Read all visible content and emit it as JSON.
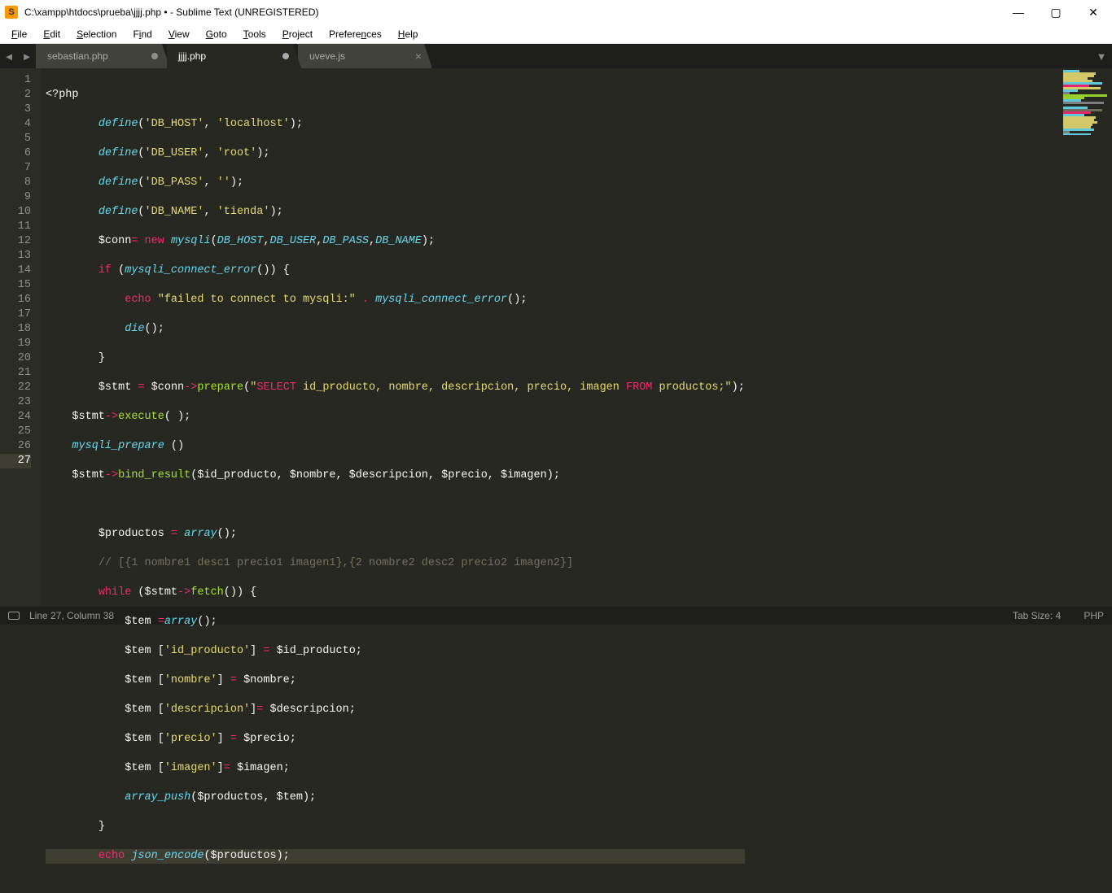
{
  "window": {
    "icon_letter": "S",
    "title": "C:\\xampp\\htdocs\\prueba\\jjjj.php • - Sublime Text (UNREGISTERED)"
  },
  "menu": {
    "file": "File",
    "edit": "Edit",
    "selection": "Selection",
    "find": "Find",
    "view": "View",
    "goto": "Goto",
    "tools": "Tools",
    "project": "Project",
    "preferences": "Preferences",
    "help": "Help"
  },
  "tabs": {
    "t1": "sebastian.php",
    "t2": "jjjj.php",
    "t3": "uveve.js"
  },
  "status": {
    "pos": "Line 27, Column 38",
    "tabsize": "Tab Size: 4",
    "lang": "PHP"
  },
  "gutter": [
    "1",
    "2",
    "3",
    "4",
    "5",
    "6",
    "7",
    "8",
    "9",
    "10",
    "11",
    "12",
    "13",
    "14",
    "15",
    "16",
    "17",
    "18",
    "19",
    "20",
    "21",
    "22",
    "23",
    "24",
    "25",
    "26",
    "27"
  ],
  "code": {
    "l1a": "<?php",
    "l2_def": "define",
    "l2_s1": "'DB_HOST'",
    "l2_s2": "'localhost'",
    "l3_s1": "'DB_USER'",
    "l3_s2": "'root'",
    "l4_s1": "'DB_PASS'",
    "l4_s2": "''",
    "l5_s1": "'DB_NAME'",
    "l5_s2": "'tienda'",
    "l6_conn": "$conn",
    "l6_new": "new",
    "l6_mysqli": "mysqli",
    "l6_c1": "DB_HOST",
    "l6_c2": "DB_USER",
    "l6_c3": "DB_PASS",
    "l6_c4": "DB_NAME",
    "l7_if": "if",
    "l7_fn": "mysqli_connect_error",
    "l8_echo": "echo",
    "l8_str": "\"failed to connect to mysqli:\"",
    "l8_fn": "mysqli_connect_error",
    "l9_die": "die",
    "l11_stmt": "$stmt",
    "l11_conn": "$conn",
    "l11_prep": "prepare",
    "l11_sql_sel": "SELECT",
    "l11_sql_mid": " id_producto, nombre, descripcion, precio, imagen ",
    "l11_sql_from": "FROM",
    "l11_sql_end": " productos;",
    "l12_stmt": "$stmt",
    "l12_exec": "execute",
    "l13_fn": "mysqli_prepare",
    "l14_stmt": "$stmt",
    "l14_bind": "bind_result",
    "l14_args": "($id_producto, $nombre, $descripcion, $precio, $imagen);",
    "l16_prod": "$productos",
    "l16_arr": "array",
    "l17_c": "// [{1 nombre1 desc1 precio1 imagen1},{2 nombre2 desc2 precio2 imagen2}]",
    "l18_while": "while",
    "l18_stmt": "$stmt",
    "l18_fetch": "fetch",
    "l19_tem": "$tem",
    "l19_arr": "array",
    "l20_k": "'id_producto'",
    "l20_v": "$id_producto",
    "l21_k": "'nombre'",
    "l21_v": "$nombre",
    "l22_k": "'descripcion'",
    "l22_v": "$descripcion",
    "l23_k": "'precio'",
    "l23_v": "$precio",
    "l24_k": "'imagen'",
    "l24_v": "$imagen",
    "l25_fn": "array_push",
    "l25_args": "($productos, $tem);",
    "l27_echo": "echo",
    "l27_fn": "json_encode",
    "l27_arg": "($productos);"
  }
}
